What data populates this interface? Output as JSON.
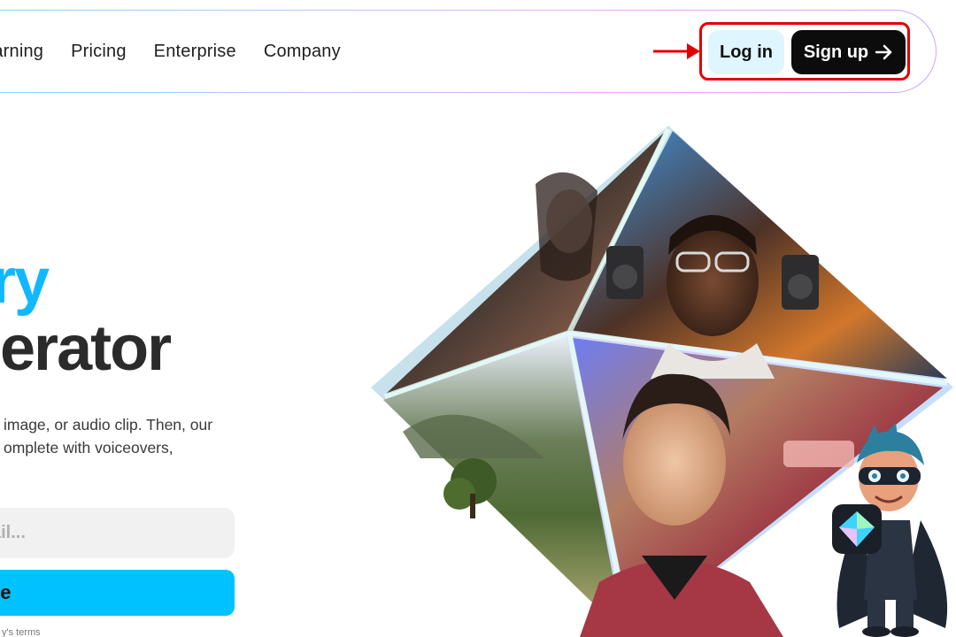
{
  "nav": {
    "links": [
      "earning",
      "Pricing",
      "Enterprise",
      "Company"
    ],
    "login_label": "Log in",
    "signup_label": "Sign up"
  },
  "hero": {
    "title_line1": "ry",
    "title_line2": "erator",
    "subtitle": "image, or audio clip. Then, our omplete with voiceovers,",
    "email_placeholder": "ail...",
    "cta_label": "ee",
    "terms": "y's terms"
  },
  "colors": {
    "accent": "#00c2ff",
    "title_accent": "#12b8ff",
    "login_bg": "#dff5ff",
    "signup_bg": "#0c0c0c",
    "annotation_red": "#e00000"
  },
  "icons": {
    "signup_arrow": "arrow-right-icon",
    "annotation_arrow": "red-arrow-icon"
  }
}
